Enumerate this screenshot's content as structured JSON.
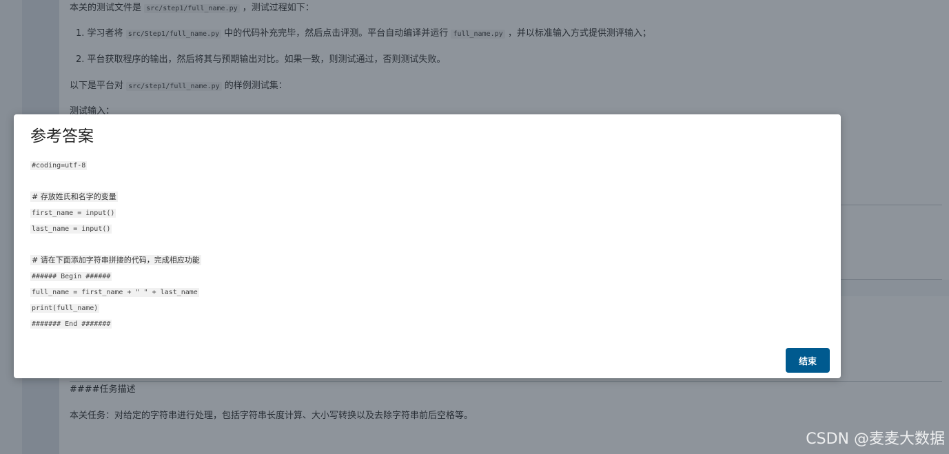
{
  "background": {
    "intro": {
      "prefix": "本关的测试文件是",
      "file": "src/step1/full_name.py",
      "suffix": "，测试过程如下："
    },
    "step1": {
      "prefix": "1. 学习者将",
      "file": "src/Step1/full_name.py",
      "middle": "中的代码补充完毕，然后点击评测。平台自动编译并运行",
      "file2": "full_name.py",
      "suffix": "，并以标准输入方式提供测评输入；"
    },
    "step2": "2. 平台获取程序的输出，然后将其与预期输出对比。如果一致，则测试通过，否则测试失败。",
    "sample": {
      "prefix": "以下是平台对",
      "file": "src/step1/full_name.py",
      "suffix": "的样例测试集："
    },
    "test_input": "测试输入：",
    "task_heading": "####任务描述",
    "task_text": "本关任务：对给定的字符串进行处理，包括字符串长度计算、大小写转换以及去除字符串前后空格等。"
  },
  "modal": {
    "title": "参考答案",
    "code_lines": [
      "#coding=utf-8",
      "",
      "# 存放姓氏和名字的变量",
      "first_name = input()",
      "last_name = input()",
      "",
      "# 请在下面添加字符串拼接的代码，完成相应功能",
      "###### Begin ######",
      "full_name = first_name + \" \" + last_name",
      "print(full_name)",
      "####### End #######"
    ],
    "end_button": "结束"
  },
  "watermark": "CSDN @麦麦大数据",
  "colors": {
    "button": "#005a8f",
    "overlay": "rgba(30,42,56,0.5)"
  }
}
